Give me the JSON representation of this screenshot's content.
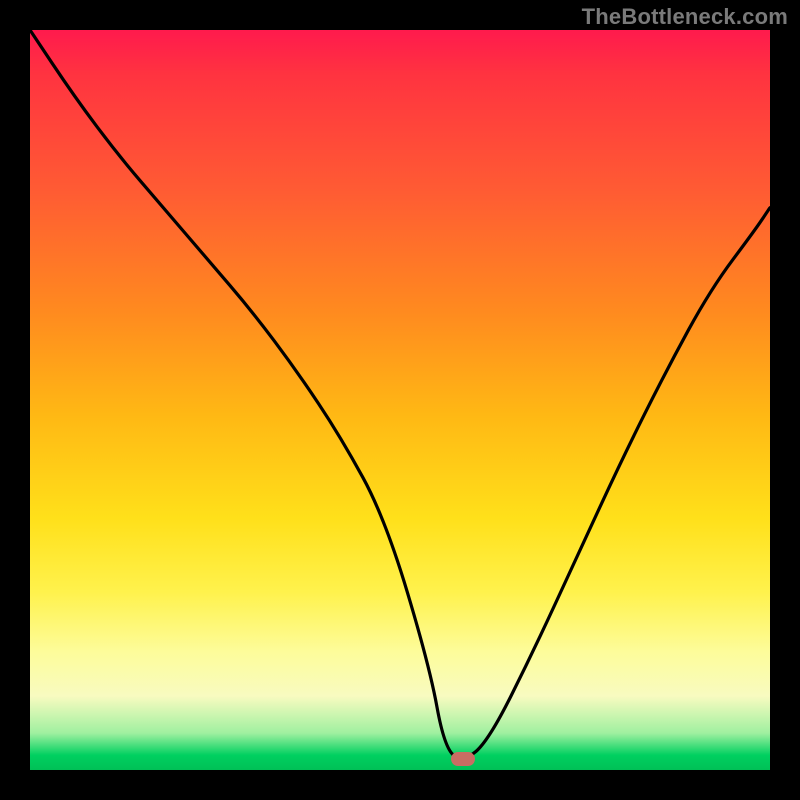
{
  "watermark": "TheBottleneck.com",
  "colors": {
    "background": "#000000",
    "gradient_top": "#ff1a4d",
    "gradient_mid": "#ffe01a",
    "gradient_bottom": "#00c056",
    "curve": "#000000",
    "marker": "#c86d63"
  },
  "marker": {
    "x_frac": 0.585,
    "y_frac": 0.985
  },
  "chart_data": {
    "type": "line",
    "title": "",
    "xlabel": "",
    "ylabel": "",
    "xlim": [
      0,
      1
    ],
    "ylim": [
      0,
      1
    ],
    "background": "rainbow-vertical-gradient",
    "annotations": [
      {
        "text": "TheBottleneck.com",
        "pos": "top-right"
      }
    ],
    "series": [
      {
        "name": "bottleneck-curve",
        "x": [
          0.0,
          0.06,
          0.12,
          0.18,
          0.24,
          0.3,
          0.36,
          0.42,
          0.48,
          0.54,
          0.56,
          0.585,
          0.62,
          0.68,
          0.74,
          0.8,
          0.86,
          0.92,
          0.98,
          1.0
        ],
        "y": [
          1.0,
          0.91,
          0.83,
          0.76,
          0.69,
          0.62,
          0.54,
          0.45,
          0.34,
          0.14,
          0.03,
          0.01,
          0.04,
          0.16,
          0.29,
          0.42,
          0.54,
          0.65,
          0.73,
          0.76
        ],
        "note": "x,y are normalized to the plot area; (0,0)=bottom-left, (1,1)=top-left of the gradient region. Curve dips to ~0 near x≈0.585 where the marker sits."
      }
    ],
    "marker": {
      "x": 0.585,
      "y": 0.015,
      "shape": "rounded-rect",
      "color": "#c86d63"
    }
  }
}
